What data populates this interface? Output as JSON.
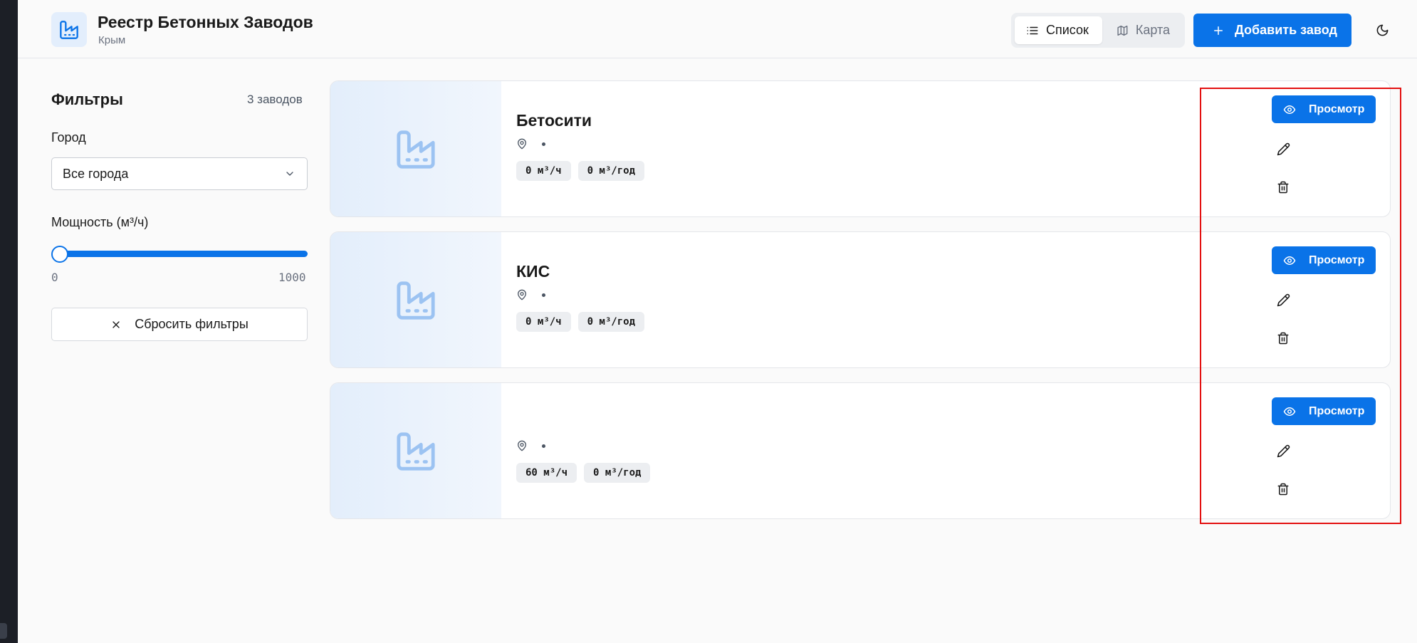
{
  "header": {
    "title": "Реестр Бетонных Заводов",
    "subtitle": "Крым",
    "view_list_label": "Список",
    "view_map_label": "Карта",
    "add_button_label": "Добавить завод",
    "active_view": "list"
  },
  "sidebar": {
    "title": "Фильтры",
    "count": "3 заводов",
    "city_label": "Город",
    "city_value": "Все города",
    "capacity_label": "Мощность (м³/ч)",
    "capacity_min": "0",
    "capacity_max": "1000",
    "capacity_value_fraction": 0,
    "reset_label": "Сбросить фильтры"
  },
  "plants": [
    {
      "name": "Бетосити",
      "hourly": "0 м³/ч",
      "yearly": "0 м³/год",
      "view_label": "Просмотр"
    },
    {
      "name": "КИС",
      "hourly": "0 м³/ч",
      "yearly": "0 м³/год",
      "view_label": "Просмотр"
    },
    {
      "name": "",
      "hourly": "60 м³/ч",
      "yearly": "0 м³/год",
      "view_label": "Просмотр"
    }
  ],
  "colors": {
    "accent": "#0a73e8",
    "highlight": "#e31010",
    "placeholder_icon": "#9cc3f2"
  },
  "icons": {
    "logo": "factory-icon",
    "list": "list-icon",
    "map": "map-icon",
    "add": "plus-icon",
    "theme": "moon-icon",
    "dropdown": "chevron-down-icon",
    "reset": "close-icon",
    "location": "map-pin-icon",
    "view": "eye-icon",
    "edit": "pencil-icon",
    "delete": "trash-icon"
  }
}
